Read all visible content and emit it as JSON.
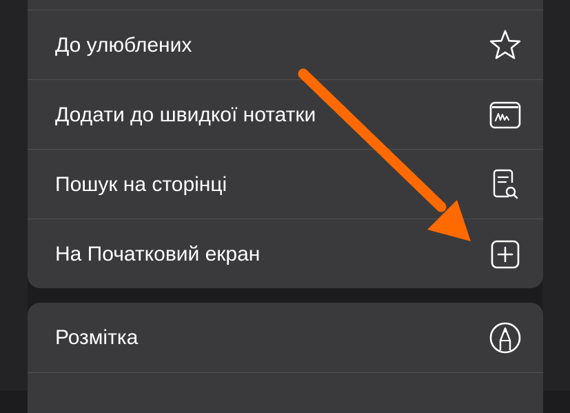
{
  "menu_top": {
    "items": [
      {
        "label": "До улюблених",
        "icon": "star-icon"
      },
      {
        "label": "Додати до швидкої нотатки",
        "icon": "quick-note-icon"
      },
      {
        "label": "Пошук на сторінці",
        "icon": "find-on-page-icon"
      },
      {
        "label": "На Початковий екран",
        "icon": "add-to-home-screen-icon"
      }
    ]
  },
  "menu_bottom": {
    "items": [
      {
        "label": "Розмітка",
        "icon": "markup-icon"
      }
    ]
  },
  "annotation": {
    "arrow_color": "#ff6a00",
    "points_to": "На Початковий екран"
  },
  "colors": {
    "panel": "#3a3a3c",
    "background": "#1c1c1e",
    "text": "#ffffff",
    "divider": "#505053"
  }
}
